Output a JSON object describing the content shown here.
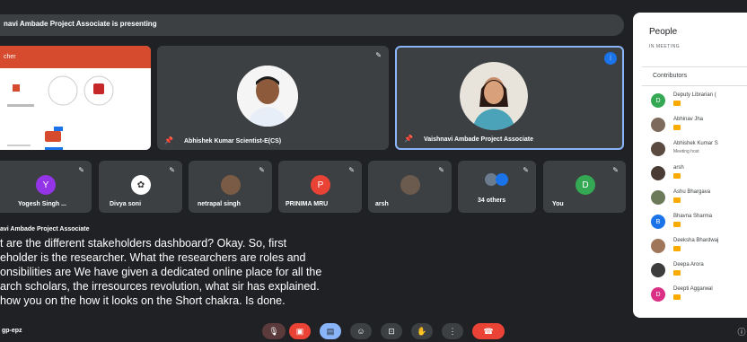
{
  "presenting_banner": "navi Ambade Project Associate is presenting",
  "slide": {
    "header": "cher"
  },
  "main_tiles": [
    {
      "name": "Abhishek Kumar Scientist-E(CS)"
    },
    {
      "name": "Vaishnavi Ambade Project Associate"
    }
  ],
  "small_tiles": [
    {
      "name": "Yogesh Singh ...",
      "initial": "Y",
      "color": "#9334e6"
    },
    {
      "name": "Divya soni"
    },
    {
      "name": "netrapal singh"
    },
    {
      "name": "PRINIMA MRU",
      "initial": "P",
      "color": "#ea4335"
    },
    {
      "name": "arsh"
    },
    {
      "name": "34 others"
    },
    {
      "name": "You",
      "initial": "D",
      "color": "#34a853"
    }
  ],
  "caption": {
    "speaker": "avi Ambade Project Associate",
    "lines": [
      "t are the different stakeholders dashboard? Okay. So, first",
      "eholder is the researcher. What the researchers are roles and",
      "onsibilities are We have given a dedicated online place for all the",
      "arch scholars, the irresources revolution, what sir has explained.",
      "how you on the how it looks on the Short chakra. Is done."
    ]
  },
  "people_panel": {
    "title": "People",
    "subtitle": "IN MEETING",
    "section": "Contributors",
    "people": [
      {
        "name": "Deputy Librarian (",
        "initial": "D",
        "color": "#34a853"
      },
      {
        "name": "Abhinav Jha",
        "photo": true
      },
      {
        "name": "Abhishek Kumar S",
        "sub": "Meeting host",
        "photo": true
      },
      {
        "name": "arsh",
        "photo": true
      },
      {
        "name": "Ashu Bhargava",
        "photo": true
      },
      {
        "name": "Bhavna Sharma",
        "initial": "B",
        "color": "#1a73e8"
      },
      {
        "name": "Deeksha Bhardwaj",
        "photo": true
      },
      {
        "name": "Deepa Arora",
        "photo": true
      },
      {
        "name": "Deepti Aggarwal",
        "initial": "D",
        "color": "#d93086"
      }
    ]
  },
  "meeting_code": "gp-epz",
  "colors": {
    "end_call": "#ea4335",
    "accent_blue": "#8ab4f8",
    "badge": "#f9ab00"
  }
}
